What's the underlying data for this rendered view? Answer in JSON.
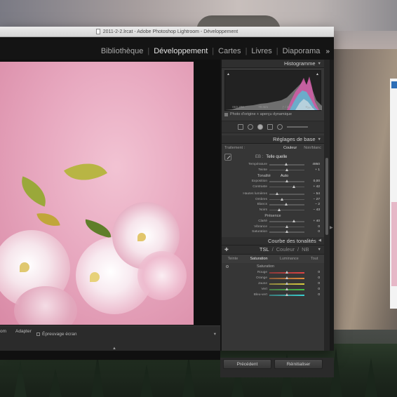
{
  "window": {
    "title": "2011-2-2.lrcat - Adobe Photoshop Lightroom - Développement"
  },
  "modules": [
    {
      "label": "Bibliothèque",
      "active": false
    },
    {
      "label": "Développement",
      "active": true
    },
    {
      "label": "Cartes",
      "active": false
    },
    {
      "label": "Livres",
      "active": false
    },
    {
      "label": "Diaporama",
      "active": false
    }
  ],
  "module_more": "»",
  "histogram": {
    "title": "Histogramme",
    "iso": "ISO 200",
    "focal": "70 mm",
    "aperture": "ƒ / 2,8",
    "shutter": "¹⁄₂₅₀ s",
    "info": "Photo d'origine + aperçu dynamique"
  },
  "basic": {
    "title": "Réglages de base",
    "treatment_label": "Traitement :",
    "treatment_color": "Couleur",
    "treatment_bw": "Noir/blanc",
    "wb_label": "EB :",
    "wb_value": "Telle quelle",
    "tone_label": "Tonalité",
    "tone_auto": "Auto",
    "presence_label": "Présence",
    "sliders_wb": [
      {
        "label": "Température",
        "value": "4950",
        "pos": 0.48
      },
      {
        "label": "Teinte",
        "value": "+ 1",
        "pos": 0.5
      }
    ],
    "sliders_tone": [
      {
        "label": "Exposition",
        "value": "0,00",
        "pos": 0.5
      },
      {
        "label": "Contraste",
        "value": "+ 42",
        "pos": 0.7
      }
    ],
    "sliders_tone2": [
      {
        "label": "Hautes lumières",
        "value": "− 54",
        "pos": 0.23
      },
      {
        "label": "Ombres",
        "value": "− 27",
        "pos": 0.36
      },
      {
        "label": "Blancs",
        "value": "− 2",
        "pos": 0.49
      },
      {
        "label": "Noirs",
        "value": "− 43",
        "pos": 0.28
      }
    ],
    "sliders_presence": [
      {
        "label": "Clarté",
        "value": "+ 40",
        "pos": 0.7
      },
      {
        "label": "Vibrance",
        "value": "0",
        "pos": 0.5
      },
      {
        "label": "Saturation",
        "value": "0",
        "pos": 0.5
      }
    ]
  },
  "curve": {
    "title": "Courbe des tonalités"
  },
  "tsl": {
    "title_tsl": "TSL",
    "title_color": "Couleur",
    "title_nb": "NB",
    "tabs": [
      "Teinte",
      "Saturation",
      "Luminance",
      "Tout"
    ],
    "active_tab": "Saturation",
    "sub": "Saturation",
    "rows": [
      {
        "label": "Rouge",
        "value": "0",
        "colors": [
          "#8a3a3a",
          "#e04444"
        ]
      },
      {
        "label": "Orange",
        "value": "0",
        "colors": [
          "#8a5a3a",
          "#e08a3a"
        ]
      },
      {
        "label": "Jaune",
        "value": "0",
        "colors": [
          "#8a8240",
          "#d8cc40"
        ]
      },
      {
        "label": "Vert",
        "value": "0",
        "colors": [
          "#4a7a4a",
          "#44c044"
        ]
      },
      {
        "label": "Bleu-vert",
        "value": "0",
        "colors": [
          "#3a7a7a",
          "#3ad0d0"
        ]
      }
    ]
  },
  "buttons": {
    "previous": "Précédent",
    "reset": "Réinitialiser"
  },
  "toolbar": {
    "zoom": "om",
    "fit": "Adapter",
    "proof": "Épreuvage écran"
  }
}
